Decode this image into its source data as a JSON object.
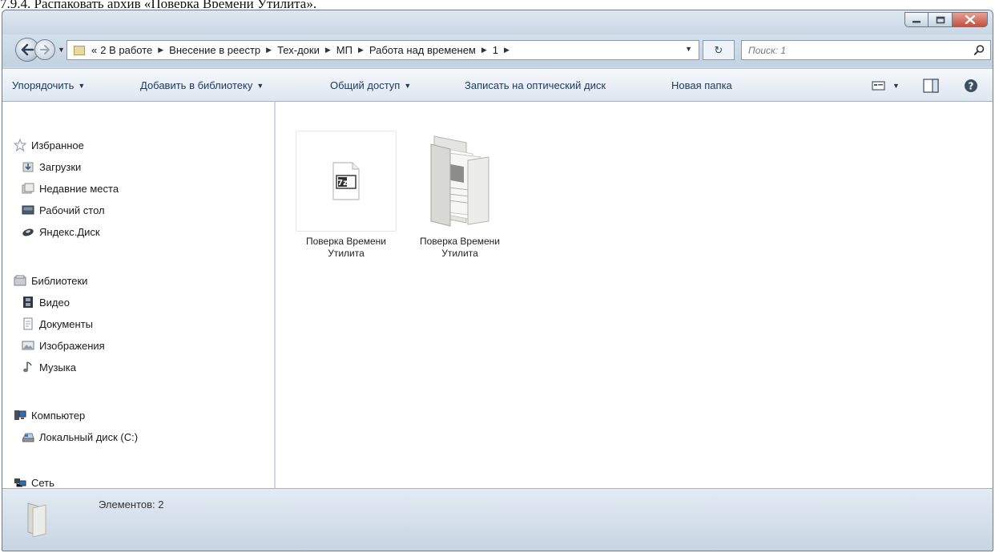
{
  "doc_heading": "7.9.4. Распаковать архив «Поверка Времени Утилита».",
  "window": {
    "controls": [
      "minimize-icon",
      "maximize-icon",
      "close-icon"
    ]
  },
  "address": {
    "prefix": "«",
    "crumbs": [
      "2 В работе",
      "Внесение в реестр",
      "Тех-доки",
      "МП",
      "Работа над временем",
      "1"
    ],
    "refresh_glyph": "↻",
    "search_placeholder": "Поиск: 1"
  },
  "toolbar": {
    "organize": "Упорядочить",
    "add_to_library": "Добавить в библиотеку",
    "share": "Общий доступ",
    "burn": "Записать на оптический диск",
    "new_folder": "Новая папка"
  },
  "sidebar": {
    "favorites": {
      "label": "Избранное",
      "items": [
        "Загрузки",
        "Недавние места",
        "Рабочий стол",
        "Яндекс.Диск"
      ]
    },
    "libraries": {
      "label": "Библиотеки",
      "items": [
        "Видео",
        "Документы",
        "Изображения",
        "Музыка"
      ]
    },
    "computer": {
      "label": "Компьютер",
      "items": [
        "Локальный диск (C:)"
      ]
    },
    "network": {
      "label": "Сеть"
    }
  },
  "files": [
    {
      "name": "Поверка Времени Утилита",
      "type": "7z-archive",
      "badge": "7z"
    },
    {
      "name": "Поверка Времени Утилита",
      "type": "folder"
    }
  ],
  "status": {
    "text": "Элементов: 2"
  },
  "colors": {
    "chrome": "#c9d7e4",
    "command_text": "#1e395b",
    "close_button": "#c3513f"
  }
}
